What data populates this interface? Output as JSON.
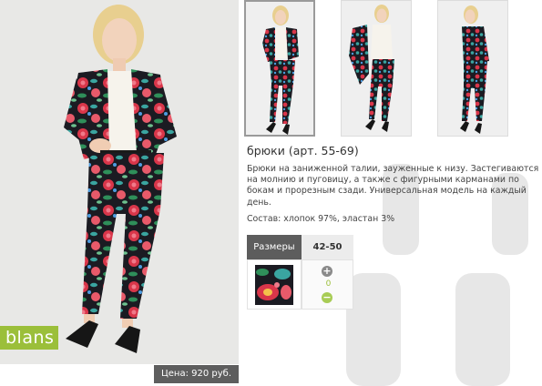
{
  "brand": {
    "logo_text": "blans"
  },
  "product": {
    "title": "брюки (арт. 55-69)",
    "description": "Брюки на заниженной талии, зауженные к низу. Застегиваются на молнию и пуговицу, а также с фигурными карманами по бокам и прорезным сзади. Универсальная модель на каждый день.",
    "composition": "Состав: хлопок 97%, эластан 3%",
    "price": "Цена: 920 руб."
  },
  "sizes": {
    "header": "Размеры",
    "value": "42-50"
  },
  "order": {
    "plus": "+",
    "minus": "−",
    "quantity": "0"
  },
  "thumbnails": [
    {
      "name": "thumb-front-jacket"
    },
    {
      "name": "thumb-front-holding-jacket"
    },
    {
      "name": "thumb-side-jacket"
    }
  ],
  "colors": {
    "accent_green": "#9bbf3a",
    "dark_gray": "#5d5d5d",
    "print_red": "#d9364a"
  }
}
